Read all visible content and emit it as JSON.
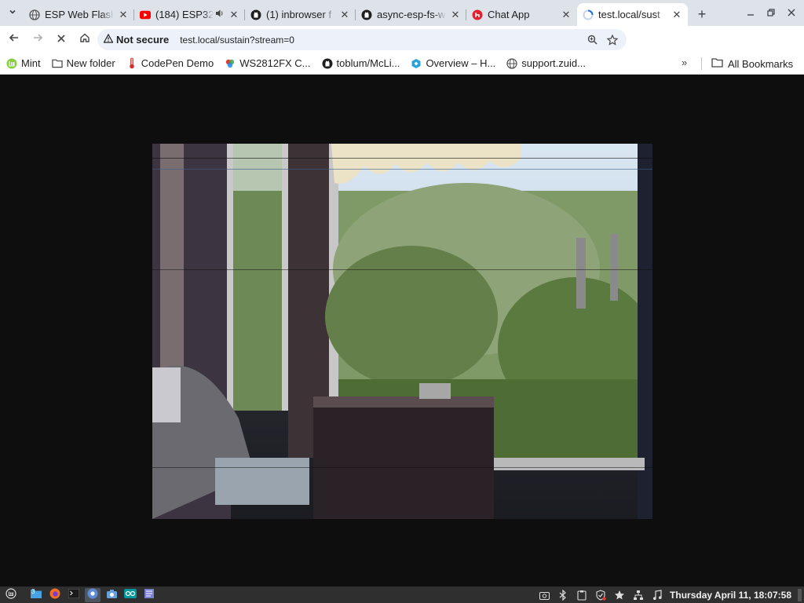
{
  "window": {
    "tabs": [
      {
        "title": "ESP Web Flash",
        "favicon": "globe-icon"
      },
      {
        "title": "(184) ESP32",
        "favicon": "youtube-icon",
        "audio": true
      },
      {
        "title": "(1) inbrowser f",
        "favicon": "github-icon"
      },
      {
        "title": "async-esp-fs-w",
        "favicon": "github-icon"
      },
      {
        "title": "Chat App",
        "favicon": "chat-app-icon"
      },
      {
        "title": "test.local/sust",
        "favicon": "loading-icon",
        "active": true
      }
    ]
  },
  "toolbar": {
    "security_label": "Not secure",
    "url": "test.local/sustain?stream=0"
  },
  "bookmarks": {
    "items": [
      {
        "label": "Mint",
        "icon": "mint-icon"
      },
      {
        "label": "New folder",
        "icon": "folder-icon"
      },
      {
        "label": "CodePen Demo",
        "icon": "thermometer-icon"
      },
      {
        "label": "WS2812FX C...",
        "icon": "colorwheel-icon"
      },
      {
        "label": "toblum/McLi...",
        "icon": "github-icon"
      },
      {
        "label": "Overview – H...",
        "icon": "huggingface-icon"
      },
      {
        "label": "support.zuid...",
        "icon": "globe-icon"
      }
    ],
    "more": "»",
    "all_label": "All Bookmarks"
  },
  "taskbar": {
    "workspace_badge": "3",
    "clock": "Thursday April 11, 18:07:58"
  },
  "colors": {
    "tabstrip": "#dee3ea",
    "omnibox": "#edf2fa",
    "page_bg": "#0e0e0e",
    "taskbar": "#2f2f2f"
  }
}
